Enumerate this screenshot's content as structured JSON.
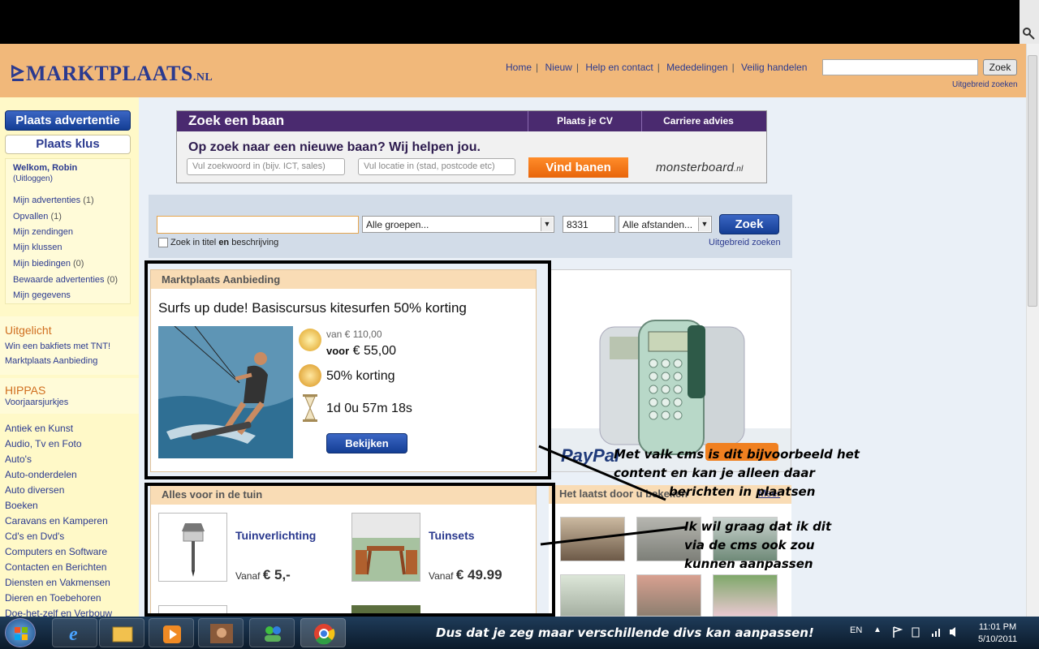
{
  "header": {
    "logo_main": "MARKTPLAATS",
    "logo_tld": ".NL",
    "nav": [
      "Home",
      "Nieuw",
      "Help en contact",
      "Mededelingen",
      "Veilig handelen"
    ],
    "search_button": "Zoek",
    "advanced_search": "Uitgebreid zoeken"
  },
  "sidebar": {
    "place_ad": "Plaats advertentie",
    "place_job": "Plaats klus",
    "welcome": "Welkom, Robin",
    "logout": "(Uitloggen)",
    "links": [
      {
        "label": "Mijn advertenties",
        "count": "(1)"
      },
      {
        "label": "Opvallen",
        "count": "(1)"
      },
      {
        "label": "Mijn zendingen",
        "count": ""
      },
      {
        "label": "Mijn klussen",
        "count": ""
      },
      {
        "label": "Mijn biedingen",
        "count": "(0)"
      },
      {
        "label": "Bewaarde advertenties",
        "count": "(0)"
      },
      {
        "label": "Mijn gegevens",
        "count": ""
      }
    ],
    "featured_title": "Uitgelicht",
    "featured_links": [
      "Win een bakfiets met TNT!",
      "Marktplaats Aanbieding"
    ],
    "hippas_title": "HIPPAS",
    "hippas_link": "Voorjaarsjurkjes",
    "categories": [
      "Antiek en Kunst",
      "Audio, Tv en Foto",
      "Auto's",
      "Auto-onderdelen",
      "Auto diversen",
      "Boeken",
      "Caravans en Kamperen",
      "Cd's en Dvd's",
      "Computers en Software",
      "Contacten en Berichten",
      "Diensten en Vakmensen",
      "Dieren en Toebehoren",
      "Doe-het-zelf en Verbouw"
    ]
  },
  "banner": {
    "title": "Zoek een baan",
    "tab1": "Plaats je CV",
    "tab2": "Carriere advies",
    "tagline": "Op zoek naar een nieuwe baan? Wij helpen jou.",
    "keyword_placeholder": "Vul zoekwoord in (bijv. ICT, sales)",
    "location_placeholder": "Vul locatie in (stad, postcode etc)",
    "button": "Vind banen",
    "brand": "monsterboard",
    "brand_tld": ".nl"
  },
  "search": {
    "group": "Alle groepen...",
    "postcode": "8331",
    "distance": "Alle afstanden...",
    "button": "Zoek",
    "checkbox_pre": "Zoek in titel ",
    "checkbox_bold": "en",
    "checkbox_post": " beschrijving",
    "advanced": "Uitgebreid zoeken"
  },
  "offer": {
    "section_title": "Marktplaats Aanbieding",
    "headline": "Surfs up dude! Basiscursus kitesurfen 50% korting",
    "old_price": "van € 110,00",
    "new_price_label": "voor",
    "new_price": "€ 55,00",
    "discount": "50% korting",
    "countdown": "1d 0u 57m 18s",
    "button": "Bekijken"
  },
  "ad": {
    "brand": "PayPal"
  },
  "garden": {
    "section_title": "Alles voor in de tuin",
    "items": [
      {
        "name": "Tuinverlichting",
        "from": "Vanaf",
        "price": "€ 5,-"
      },
      {
        "name": "Tuinsets",
        "from": "Vanaf",
        "price": "€ 49.99"
      }
    ]
  },
  "recent": {
    "title": "Het laatst door u bekeken",
    "more": "Meer"
  },
  "annotations": {
    "note1": [
      "Met valk cms is dit bijvoorbeeld het",
      "content en kan je alleen daar",
      "berichten in plaatsen"
    ],
    "note2": [
      "Ik wil graag dat ik dit",
      "via de cms ook zou",
      "kunnen aanpassen"
    ]
  },
  "taskbar": {
    "caption": "Dus dat je zeg maar verschillende divs kan aanpassen!",
    "lang": "EN",
    "time": "11:01 PM",
    "date": "5/10/2011"
  },
  "colors": {
    "header_bg": "#f1b87a",
    "brand_blue": "#2b3a8f",
    "sidebar_bg": "#fff9c8",
    "accent_orange": "#e8650a"
  }
}
